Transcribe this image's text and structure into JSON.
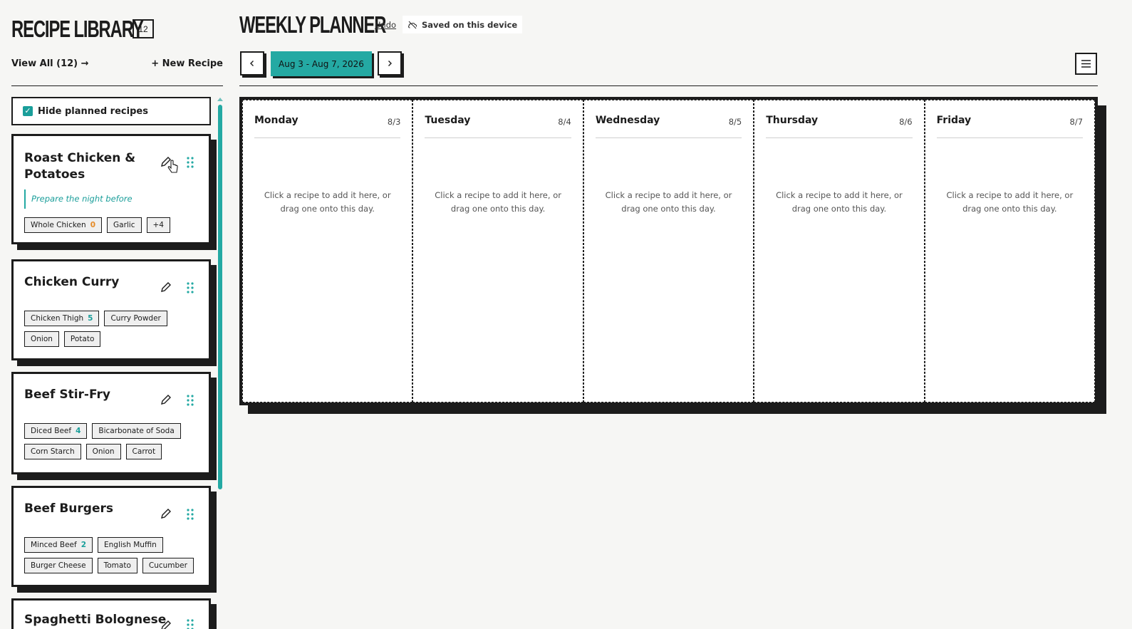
{
  "library": {
    "title": "RECIPE LIBRARY",
    "count": "12",
    "view_all": "View All (12) →",
    "new_recipe": "+ New Recipe",
    "filter_label": "Hide planned recipes",
    "filter_checked": true
  },
  "recipes": [
    {
      "title": "Roast Chicken & Potatoes",
      "note": "Prepare the night before",
      "tags": [
        {
          "label": "Whole Chicken",
          "count": "0"
        },
        {
          "label": "Garlic",
          "count": ""
        },
        {
          "label": "+4",
          "count": ""
        }
      ]
    },
    {
      "title": "Chicken Curry",
      "note": "",
      "tags": [
        {
          "label": "Chicken Thigh",
          "count": "5"
        },
        {
          "label": "Curry Powder",
          "count": ""
        },
        {
          "label": "Onion",
          "count": ""
        },
        {
          "label": "Potato",
          "count": ""
        }
      ]
    },
    {
      "title": "Beef Stir-Fry",
      "note": "",
      "tags": [
        {
          "label": "Diced Beef",
          "count": "4"
        },
        {
          "label": "Bicarbonate of Soda",
          "count": ""
        },
        {
          "label": "Corn Starch",
          "count": ""
        },
        {
          "label": "Onion",
          "count": ""
        },
        {
          "label": "Carrot",
          "count": ""
        }
      ]
    },
    {
      "title": "Beef Burgers",
      "note": "",
      "tags": [
        {
          "label": "Minced Beef",
          "count": "2"
        },
        {
          "label": "English Muffin",
          "count": ""
        },
        {
          "label": "Burger Cheese",
          "count": ""
        },
        {
          "label": "Tomato",
          "count": ""
        },
        {
          "label": "Cucumber",
          "count": ""
        }
      ]
    },
    {
      "title": "Spaghetti Bolognese",
      "note": "",
      "tags": []
    }
  ],
  "planner": {
    "title": "WEEKLY PLANNER",
    "undo": "Undo",
    "saved": "Saved on this device",
    "date_range": "Aug 3 - Aug 7, 2026",
    "empty_line1": "Click a recipe to add it here, or",
    "empty_line2": "drag one onto this day.",
    "days": [
      {
        "name": "Monday",
        "date": "8/3"
      },
      {
        "name": "Tuesday",
        "date": "8/4"
      },
      {
        "name": "Wednesday",
        "date": "8/5"
      },
      {
        "name": "Thursday",
        "date": "8/6"
      },
      {
        "name": "Friday",
        "date": "8/7"
      }
    ]
  },
  "colors": {
    "accent": "#24a9a3",
    "ink": "#1c1c1c",
    "zero_count": "#e58a26"
  }
}
